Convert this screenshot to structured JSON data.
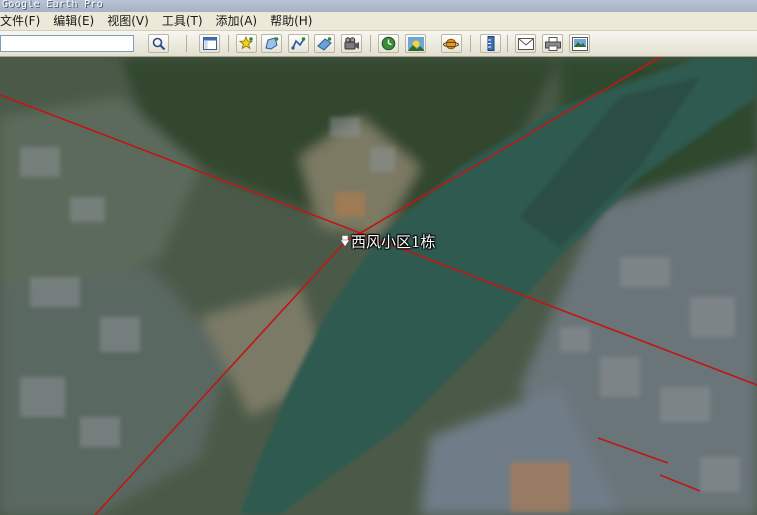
{
  "window": {
    "title": "Google Earth Pro"
  },
  "menu": {
    "items": [
      "文件(F)",
      "编辑(E)",
      "视图(V)",
      "工具(T)",
      "添加(A)",
      "帮助(H)"
    ]
  },
  "toolbar": {
    "search_value": "",
    "buttons": [
      {
        "name": "search-button",
        "icon": "magnifier-icon"
      },
      {
        "name": "sidebar-toggle-button",
        "icon": "sidebar-icon"
      },
      {
        "name": "add-placemark-button",
        "icon": "pushpin-icon"
      },
      {
        "name": "add-polygon-button",
        "icon": "polygon-icon"
      },
      {
        "name": "add-path-button",
        "icon": "path-icon"
      },
      {
        "name": "add-image-overlay-button",
        "icon": "image-overlay-icon"
      },
      {
        "name": "record-tour-button",
        "icon": "tour-camera-icon"
      },
      {
        "name": "historical-imagery-button",
        "icon": "clock-icon"
      },
      {
        "name": "sunlight-button",
        "icon": "sun-icon"
      },
      {
        "name": "switch-planet-button",
        "icon": "planet-icon"
      },
      {
        "name": "ruler-button",
        "icon": "ruler-icon"
      },
      {
        "name": "email-button",
        "icon": "envelope-icon"
      },
      {
        "name": "print-button",
        "icon": "printer-icon"
      },
      {
        "name": "save-image-button",
        "icon": "save-image-icon"
      }
    ]
  },
  "map": {
    "placemark_label": "西风小区1栋",
    "line_color": "#c01616",
    "water_color": "#2f5a50"
  }
}
